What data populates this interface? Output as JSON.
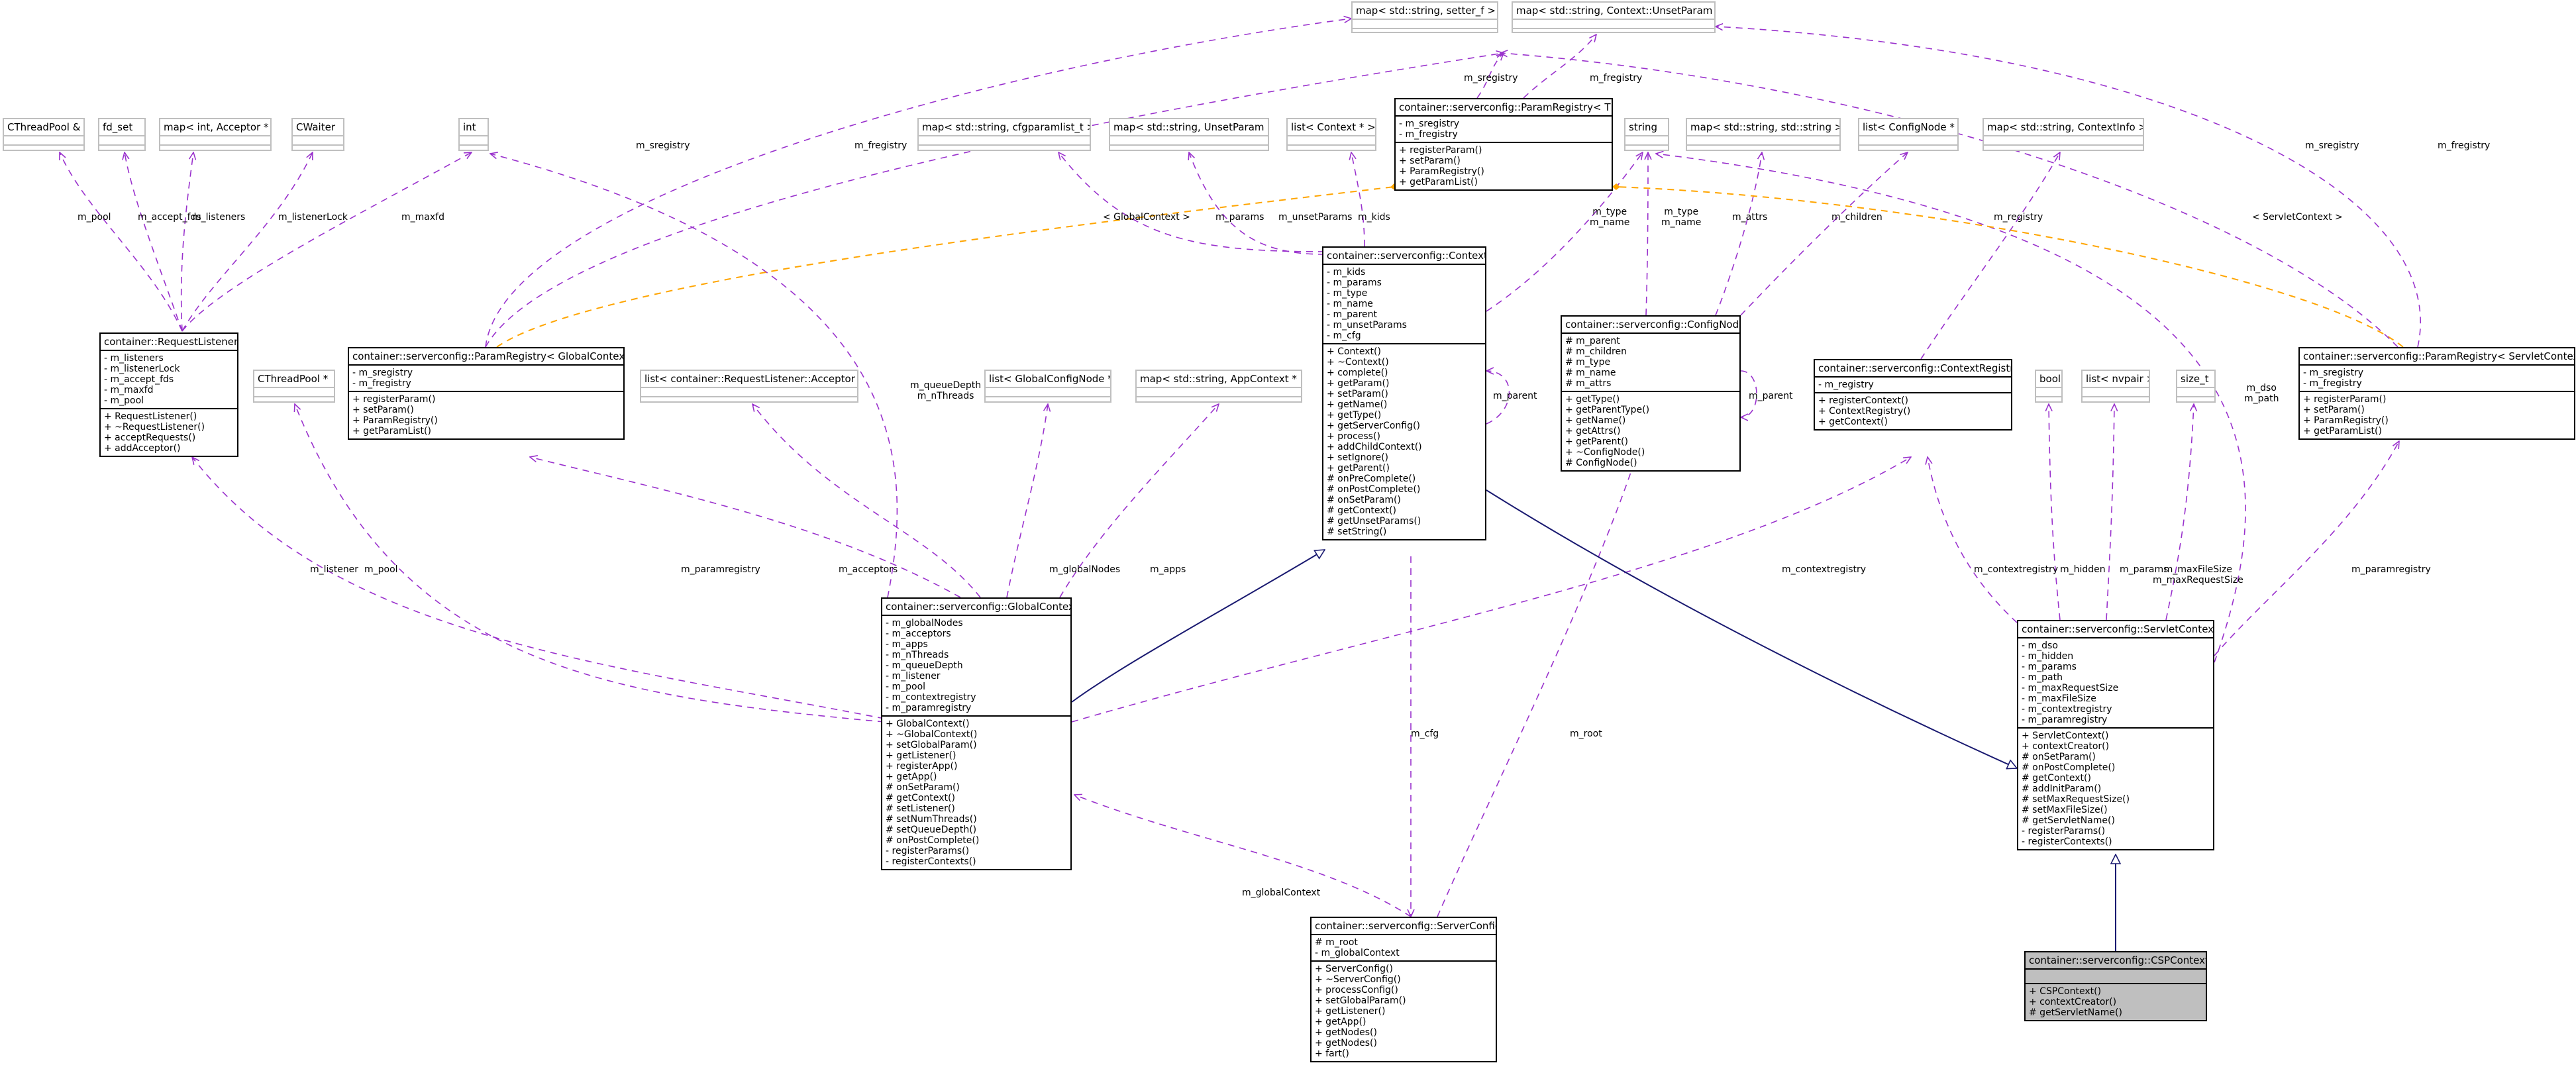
{
  "colors": {
    "dependency": "#9a32cd",
    "template": "#ffa500",
    "inheritance": "#191970",
    "external_border": "#bfbfbf",
    "highlight_fill": "#bfbfbf"
  },
  "nodes": {
    "map_setter": {
      "title": "map< std::string, setter_f >",
      "attrs": [],
      "methods": []
    },
    "map_unset": {
      "title": "map< std::string, Context::UnsetParam >",
      "attrs": [],
      "methods": []
    },
    "paramreg_t": {
      "title": "container::serverconfig::ParamRegistry< T >",
      "attrs": [
        "- m_sregistry",
        "- m_fregistry"
      ],
      "methods": [
        "+ registerParam()",
        "+ setParam()",
        "+ ParamRegistry()",
        "+ getParamList()"
      ]
    },
    "cthreadpool_ref": {
      "title": "CThreadPool &",
      "attrs": [],
      "methods": []
    },
    "fd_set": {
      "title": "fd_set",
      "attrs": [],
      "methods": []
    },
    "map_acceptor": {
      "title": "map< int, Acceptor * >",
      "attrs": [],
      "methods": []
    },
    "cwaiter": {
      "title": "CWaiter",
      "attrs": [],
      "methods": []
    },
    "int": {
      "title": "int",
      "attrs": [],
      "methods": []
    },
    "map_cfgparam": {
      "title": "map< std::string, cfgparamlist_t >",
      "attrs": [],
      "methods": []
    },
    "map_unsetparam": {
      "title": "map< std::string, UnsetParam >",
      "attrs": [],
      "methods": []
    },
    "list_context": {
      "title": "list< Context * >",
      "attrs": [],
      "methods": []
    },
    "string": {
      "title": "string",
      "attrs": [],
      "methods": []
    },
    "map_strstr": {
      "title": "map< std::string, std::string >",
      "attrs": [],
      "methods": []
    },
    "list_confignode": {
      "title": "list< ConfigNode * >",
      "attrs": [],
      "methods": []
    },
    "map_contextinfo": {
      "title": "map< std::string, ContextInfo >",
      "attrs": [],
      "methods": []
    },
    "requestlistener": {
      "title": "container::RequestListener",
      "attrs": [
        "- m_listeners",
        "- m_listenerLock",
        "- m_accept_fds",
        "- m_maxfd",
        "- m_pool"
      ],
      "methods": [
        "+ RequestListener()",
        "+ ~RequestListener()",
        "+ acceptRequests()",
        "+ addAcceptor()"
      ]
    },
    "paramreg_global": {
      "title": "container::serverconfig::ParamRegistry< GlobalContext >",
      "attrs": [
        "- m_sregistry",
        "- m_fregistry"
      ],
      "methods": [
        "+ registerParam()",
        "+ setParam()",
        "+ ParamRegistry()",
        "+ getParamList()"
      ]
    },
    "context": {
      "title": "container::serverconfig::Context",
      "attrs": [
        "- m_kids",
        "- m_params",
        "- m_type",
        "- m_name",
        "- m_parent",
        "- m_unsetParams",
        "- m_cfg"
      ],
      "methods": [
        "+ Context()",
        "+ ~Context()",
        "+ complete()",
        "+ getParam()",
        "+ setParam()",
        "+ getName()",
        "+ getType()",
        "+ getServerConfig()",
        "+ process()",
        "+ addChildContext()",
        "+ setIgnore()",
        "+ getParent()",
        "# onPreComplete()",
        "# onPostComplete()",
        "# onSetParam()",
        "# getContext()",
        "# getUnsetParams()",
        "# setString()"
      ]
    },
    "confignode": {
      "title": "container::serverconfig::ConfigNode",
      "attrs": [
        "# m_parent",
        "# m_children",
        "# m_type",
        "# m_name",
        "# m_attrs"
      ],
      "methods": [
        "+ getType()",
        "+ getParentType()",
        "+ getName()",
        "+ getAttrs()",
        "+ getParent()",
        "+ ~ConfigNode()",
        "# ConfigNode()"
      ]
    },
    "contextregistry": {
      "title": "container::serverconfig::ContextRegistry",
      "attrs": [
        "- m_registry"
      ],
      "methods": [
        "+ registerContext()",
        "+ ContextRegistry()",
        "+ getContext()"
      ]
    },
    "bool": {
      "title": "bool",
      "attrs": [],
      "methods": []
    },
    "list_nvpair": {
      "title": "list< nvpair >",
      "attrs": [],
      "methods": []
    },
    "size_t": {
      "title": "size_t",
      "attrs": [],
      "methods": []
    },
    "paramreg_servlet": {
      "title": "container::serverconfig::ParamRegistry< ServletContext >",
      "attrs": [
        "- m_sregistry",
        "- m_fregistry"
      ],
      "methods": [
        "+ registerParam()",
        "+ setParam()",
        "+ ParamRegistry()",
        "+ getParamList()"
      ]
    },
    "cthreadpool_ptr": {
      "title": "CThreadPool *",
      "attrs": [],
      "methods": []
    },
    "list_acceptor": {
      "title": "list< container::RequestListener::Acceptor * >",
      "attrs": [],
      "methods": []
    },
    "list_globalnode": {
      "title": "list< GlobalConfigNode * >",
      "attrs": [],
      "methods": []
    },
    "map_appcontext": {
      "title": "map< std::string, AppContext * >",
      "attrs": [],
      "methods": []
    },
    "globalcontext": {
      "title": "container::serverconfig::GlobalContext",
      "attrs": [
        "- m_globalNodes",
        "- m_acceptors",
        "- m_apps",
        "- m_nThreads",
        "- m_queueDepth",
        "- m_listener",
        "- m_pool",
        "- m_contextregistry",
        "- m_paramregistry"
      ],
      "methods": [
        "+ GlobalContext()",
        "+ ~GlobalContext()",
        "+ setGlobalParam()",
        "+ getListener()",
        "+ registerApp()",
        "+ getApp()",
        "# onSetParam()",
        "# getContext()",
        "# setListener()",
        "# setNumThreads()",
        "# setQueueDepth()",
        "# onPostComplete()",
        "- registerParams()",
        "- registerContexts()"
      ]
    },
    "servletcontext": {
      "title": "container::serverconfig::ServletContext",
      "attrs": [
        "- m_dso",
        "- m_hidden",
        "- m_params",
        "- m_path",
        "- m_maxRequestSize",
        "- m_maxFileSize",
        "- m_contextregistry",
        "- m_paramregistry"
      ],
      "methods": [
        "+ ServletContext()",
        "+ contextCreator()",
        "# onSetParam()",
        "# onPostComplete()",
        "# getContext()",
        "# addInitParam()",
        "# setMaxRequestSize()",
        "# setMaxFileSize()",
        "# getServletName()",
        "- registerParams()",
        "- registerContexts()"
      ]
    },
    "serverconfig": {
      "title": "container::serverconfig::ServerConfig",
      "attrs": [
        "# m_root",
        "- m_globalContext"
      ],
      "methods": [
        "+ ServerConfig()",
        "+ ~ServerConfig()",
        "+ processConfig()",
        "+ setGlobalParam()",
        "+ getListener()",
        "+ getApp()",
        "+ getNodes()",
        "+ getNodes()",
        "+ fart()"
      ]
    },
    "cspcontext": {
      "title": "container::serverconfig::CSPContext",
      "attrs": [],
      "methods": [
        "+ CSPContext()",
        "+ contextCreator()",
        "# getServletName()"
      ]
    }
  },
  "edge_labels": {
    "m_sregistry": "m_sregistry",
    "m_fregistry": "m_fregistry",
    "m_pool": "m_pool",
    "m_accept_fds": "m_accept_fds",
    "m_listeners": "m_listeners",
    "m_listenerLock": "m_listenerLock",
    "m_maxfd": "m_maxfd",
    "global_ctx_tpl": "< GlobalContext >",
    "m_params": "m_params",
    "m_unsetParams": "m_unsetParams",
    "m_kids": "m_kids",
    "ctx_type_name": "m_type\nm_name",
    "node_type_name": "m_type\nm_name",
    "m_attrs": "m_attrs",
    "m_children": "m_children",
    "m_registry": "m_registry",
    "servlet_ctx_tpl": "< ServletContext >",
    "m_queueDepth_nThreads": "m_queueDepth\nm_nThreads",
    "m_dso_path": "m_dso\nm_path",
    "m_parent": "m_parent",
    "m_parent2": "m_parent",
    "m_listener": "m_listener",
    "m_pool2": "m_pool",
    "m_paramregistry": "m_paramregistry",
    "m_acceptors": "m_acceptors",
    "m_globalNodes": "m_globalNodes",
    "m_apps": "m_apps",
    "m_contextregistry": "m_contextregistry",
    "m_contextregistry2": "m_contextregistry",
    "m_hidden": "m_hidden",
    "m_params2": "m_params",
    "m_maxFileSize": "m_maxFileSize\nm_maxRequestSize",
    "m_paramregistry2": "m_paramregistry",
    "m_cfg": "m_cfg",
    "m_root": "m_root",
    "m_globalContext": "m_globalContext",
    "m_sregistry2": "m_sregistry",
    "m_fregistry2": "m_fregistry"
  }
}
